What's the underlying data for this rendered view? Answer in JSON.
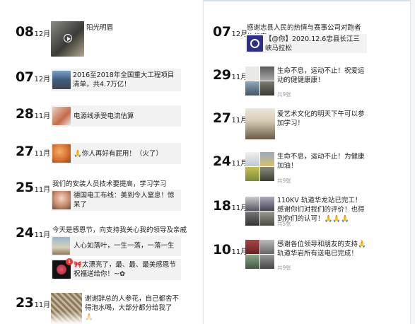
{
  "left": {
    "posts": [
      {
        "day": "08",
        "month": "12月",
        "card_text": "阳光明眉"
      },
      {
        "day": "07",
        "month": "12月",
        "card_text": "2016至2018年全国重大工程项目清单，共4.7万亿！"
      },
      {
        "day": "28",
        "month": "11月",
        "card_text": "电源线承受电流估算"
      },
      {
        "day": "27",
        "month": "11月",
        "card_text": "🙏你人再好有屁用！（火了）"
      },
      {
        "day": "25",
        "month": "11月",
        "caption": "我们的安装人员技术要提高，学习学习",
        "card_text": "德国电工布线：美到令人窒息！惊呆了"
      },
      {
        "day": "24",
        "month": "11月",
        "caption": "今天是感恩节，向支持我关心我的领导及亲戚",
        "card1_text": "人心如落叶，一生一落，一落一生",
        "card2_text": "🎀太漂亮了，最、最、最美感恩节祝福送给你！~✿",
        "badge": "1"
      },
      {
        "day": "23",
        "month": "11月",
        "card_text": "谢谢辞总的人参花，自己都舍不得泡水喝，大部分都分给我了🙏"
      }
    ]
  },
  "right": {
    "posts": [
      {
        "day": "07",
        "month": "12月",
        "caption": "感谢志县人民的热情与赛事公司对跑者的归宿",
        "card_text": "【@你】2020.12.6忠县长江三峡马拉松"
      },
      {
        "day": "29",
        "month": "11月",
        "caption": "生命不息，运动不止！祝爱运动的健健康康！",
        "count": "共9张"
      },
      {
        "day": "27",
        "month": "11月",
        "caption": "爱艺术文化的明天下午可以参加学习！"
      },
      {
        "day": "24",
        "month": "11月",
        "caption": "生命不息，运动不止！为健康加油！",
        "count": "共9张"
      },
      {
        "day": "18",
        "month": "11月",
        "caption": "110KV 轨道华龙站已完工！感谢你们对我们的评价！也得到你们的认可！🙏🙏🙏",
        "count": "共5张"
      },
      {
        "day": "10",
        "month": "11月",
        "caption": "感谢各位领导和朋友的支持🙏轨道华岩所有送电已完成！",
        "count": "共9张"
      }
    ]
  },
  "colors": {
    "card_bg": "#f2f2f2",
    "count_text": "#999999",
    "badge": "#e33333"
  },
  "icons": [
    "play-icon",
    "music-icon",
    "notification-badge"
  ]
}
